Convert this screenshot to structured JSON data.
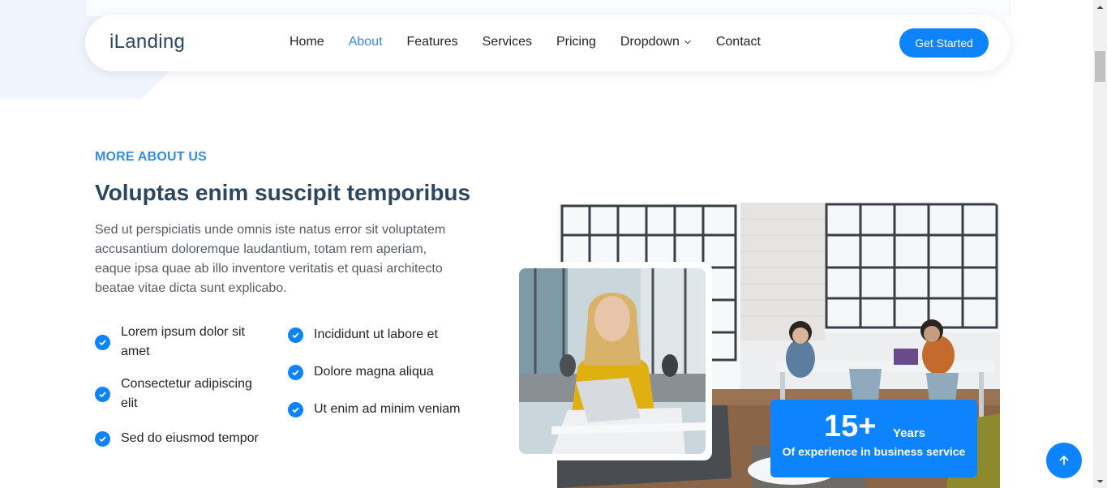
{
  "header": {
    "logo": "iLanding",
    "nav": [
      {
        "label": "Home",
        "active": false
      },
      {
        "label": "About",
        "active": true
      },
      {
        "label": "Features",
        "active": false
      },
      {
        "label": "Services",
        "active": false
      },
      {
        "label": "Pricing",
        "active": false
      },
      {
        "label": "Dropdown",
        "active": false,
        "has_chevron": true
      },
      {
        "label": "Contact",
        "active": false
      }
    ],
    "cta_label": "Get Started"
  },
  "about": {
    "eyebrow": "MORE ABOUT US",
    "heading": "Voluptas enim suscipit temporibus",
    "lead": "Sed ut perspiciatis unde omnis iste natus error sit voluptatem accusantium doloremque laudantium, totam rem aperiam, eaque ipsa quae ab illo inventore veritatis et quasi architecto beatae vitae dicta sunt explicabo.",
    "features_left": [
      "Lorem ipsum dolor sit amet",
      "Consectetur adipiscing elit",
      "Sed do eiusmod tempor"
    ],
    "features_right": [
      "Incididunt ut labore et",
      "Dolore magna aliqua",
      "Ut enim ad minim veniam"
    ]
  },
  "experience": {
    "number": "15+",
    "unit": "Years",
    "description": "Of experience in business service"
  },
  "icons": {
    "feature": "check-circle-icon",
    "dropdown": "chevron-down-icon",
    "back_to_top": "arrow-up-icon"
  },
  "colors": {
    "accent": "#0d83fd",
    "heading": "#2d465e",
    "active_link": "#388dd8"
  }
}
